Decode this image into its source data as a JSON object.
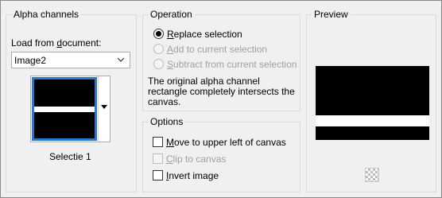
{
  "alpha_group": {
    "title": "Alpha channels",
    "load_label_pre": "Load from ",
    "load_label_ul": "d",
    "load_label_post": "ocument:",
    "document_select_value": "Image2",
    "thumbnail_caption": "Selectie 1"
  },
  "operation_group": {
    "title": "Operation",
    "options": [
      {
        "ul": "R",
        "rest": "eplace selection",
        "checked": true,
        "enabled": true
      },
      {
        "ul": "A",
        "rest": "dd to current selection",
        "checked": false,
        "enabled": false
      },
      {
        "ul": "S",
        "rest": "ubtract from current selection",
        "checked": false,
        "enabled": false
      }
    ],
    "message": [
      "The original alpha channel",
      "rectangle completely intersects the",
      "canvas."
    ]
  },
  "options_group": {
    "title": "Options",
    "checkboxes": [
      {
        "ul": "M",
        "rest": "ove to upper left of canvas",
        "checked": false,
        "enabled": true
      },
      {
        "ul": "C",
        "rest": "lip to canvas",
        "checked": false,
        "enabled": false
      },
      {
        "ul": "I",
        "rest": "nvert image",
        "checked": false,
        "enabled": true
      }
    ]
  },
  "preview_group": {
    "title": "Preview"
  },
  "icons": {
    "dropdown": "chevron-down-icon",
    "thumb_dropdown": "triangle-down-icon",
    "transparency": "checkerboard-icon"
  }
}
